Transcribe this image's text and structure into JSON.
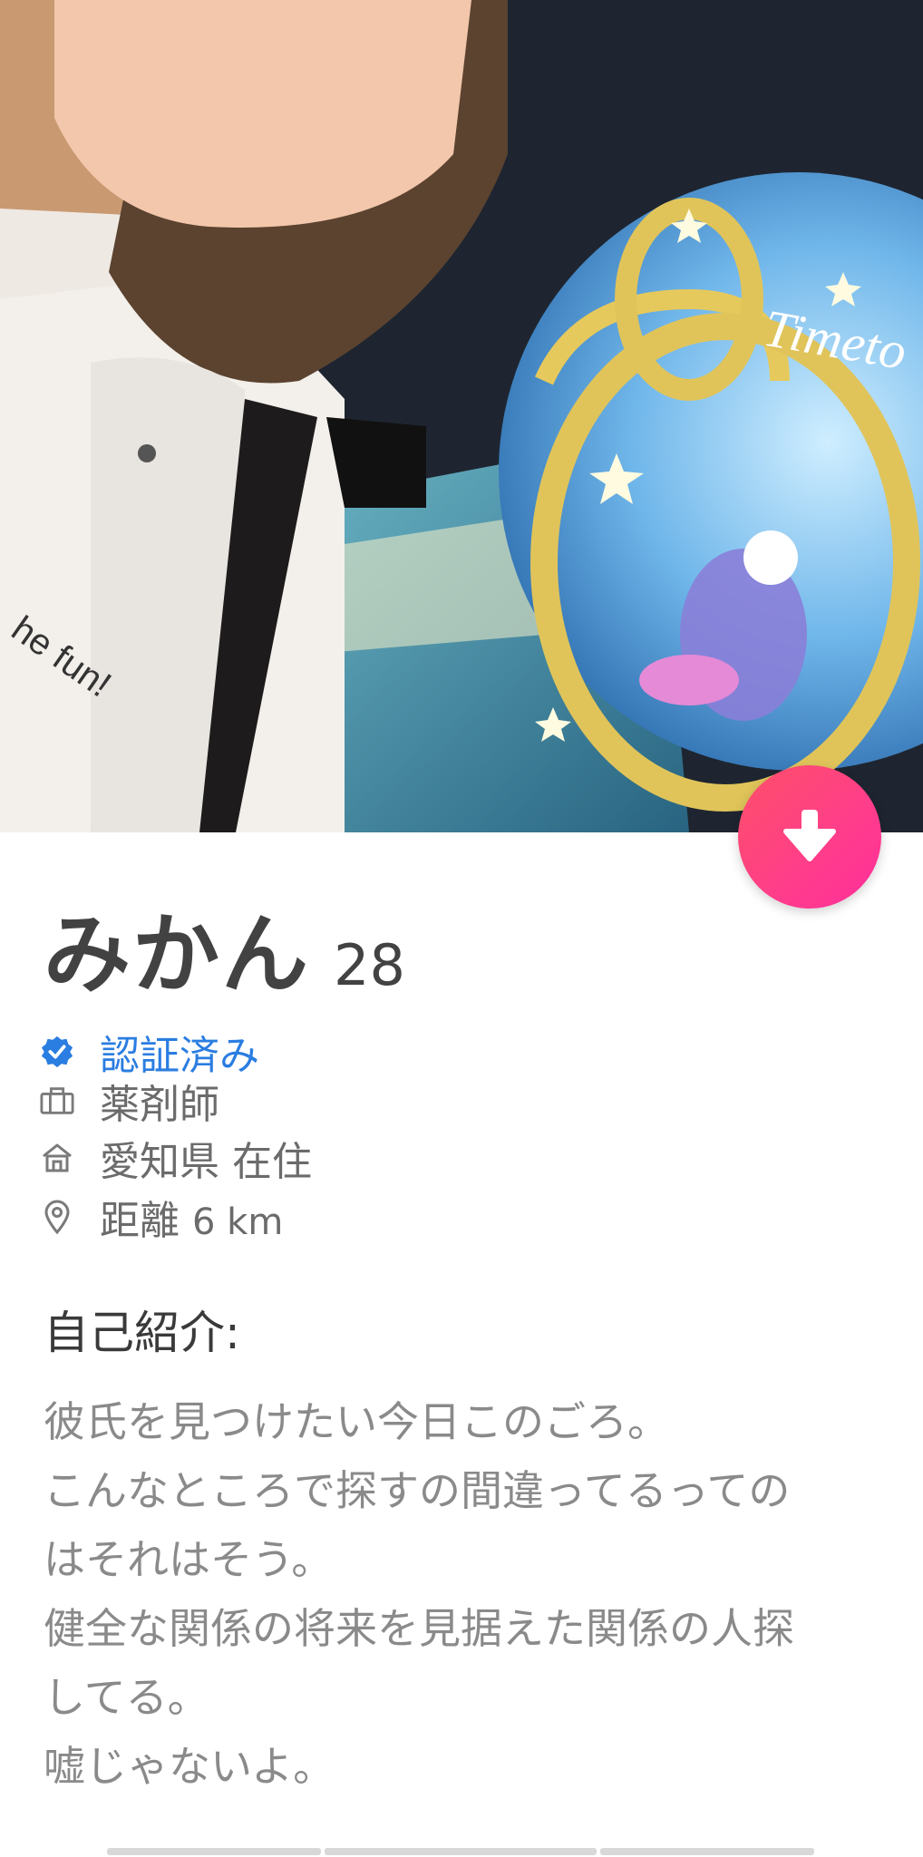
{
  "profile": {
    "name": "みかん",
    "age": "28",
    "verified_label": "認証済み",
    "job": "薬剤師",
    "residence": "愛知県 在住",
    "distance_prefix": "距離",
    "distance_value": "6 km"
  },
  "photo": {
    "shirt_text": "he fun!",
    "sign_text": "Timeto"
  },
  "bio": {
    "title": "自己紹介:",
    "lines": [
      "彼氏を見つけたい今日このごろ。",
      "こんなところで探すの間違ってるっての",
      "はそれはそう。",
      "健全な関係の将来を見据えた関係の人探",
      "してる。",
      "嘘じゃないよ。"
    ]
  },
  "icons": {
    "fab": "arrow-down-icon",
    "verified": "verified-badge-icon",
    "job": "briefcase-icon",
    "residence": "home-icon",
    "distance": "location-pin-icon"
  },
  "colors": {
    "accent_start": "#fd5068",
    "accent_end": "#ff2e9a",
    "verified_blue": "#2a7de1",
    "name_text": "#424242",
    "secondary_text": "#6b6b6b",
    "bio_text": "#8a8a8a"
  }
}
